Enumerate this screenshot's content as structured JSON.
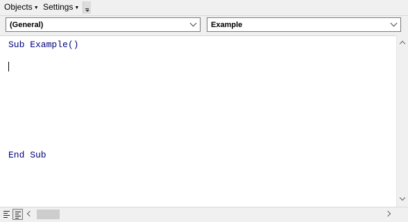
{
  "menubar": {
    "objects_label": "Objects",
    "settings_label": "Settings"
  },
  "combos": {
    "object_value": "(General)",
    "procedure_value": "Example"
  },
  "code": {
    "lines": [
      "Sub Example()",
      "End Sub"
    ],
    "keyword_color": "#00007f"
  }
}
